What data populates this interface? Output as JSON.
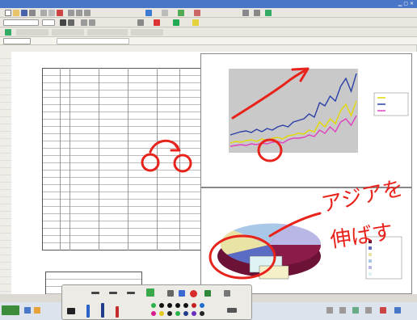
{
  "app": {
    "window_title": ""
  },
  "colors": {
    "titlebar": "#4a76c8",
    "annotation_red": "#e8231c",
    "series_blue": "#2b3fa8",
    "series_yellow": "#e5d800",
    "series_pink": "#e040c0"
  },
  "icons": [
    "new-file-icon",
    "open-icon",
    "save-icon",
    "print-icon",
    "chart-wizard-icon",
    "bold-icon",
    "italic-icon",
    "align-icon",
    "pen-icon",
    "highlighter-icon",
    "eraser-icon",
    "close-icon"
  ],
  "handwriting": [
    "アジアを",
    "伸ばす"
  ]
}
